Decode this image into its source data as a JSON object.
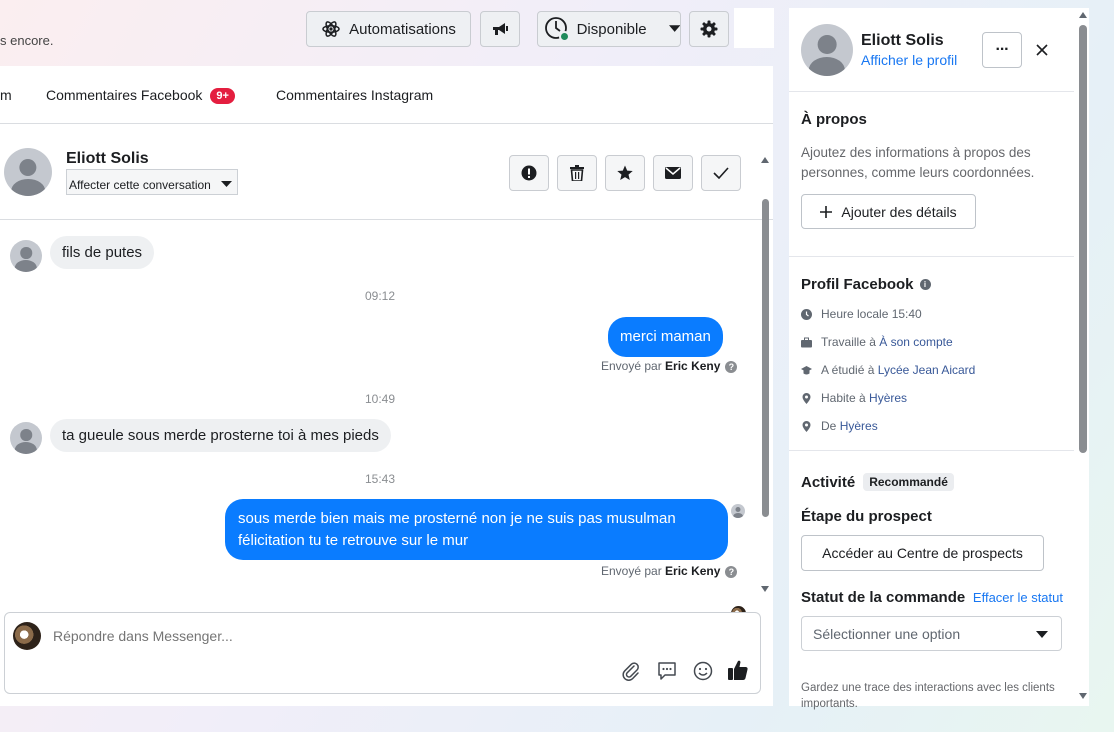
{
  "topbar": {
    "partial_text": "s encore.",
    "automations_label": "Automatisations",
    "status_label": "Disponible"
  },
  "tabs": [
    {
      "label": "m"
    },
    {
      "label": "Commentaires Facebook",
      "badge": "9+"
    },
    {
      "label": "Commentaires Instagram"
    }
  ],
  "conversation": {
    "name": "Eliott Solis",
    "assign_label": "Affecter cette conversation"
  },
  "messages": {
    "m1": "fils de putes",
    "t1": "09:12",
    "m2": "merci maman",
    "sent_prefix": "Envoyé par",
    "sender": "Eric Keny",
    "t2": "10:49",
    "m3": "ta gueule sous merde prosterne toi à mes pieds",
    "t3": "15:43",
    "m4_line1": "sous merde bien mais me prosterné non je ne suis pas musulman",
    "m4_line2": "félicitation tu te retrouve sur le mur"
  },
  "reply": {
    "placeholder": "Répondre dans Messenger..."
  },
  "side": {
    "name": "Eliott Solis",
    "profile_link": "Afficher le profil",
    "more_label": "···",
    "about_title": "À propos",
    "about_text_1": "Ajoutez des informations à propos des",
    "about_text_2": "personnes, comme leurs coordonnées.",
    "add_details": "Ajouter des détails",
    "fb_profile_title": "Profil Facebook",
    "local_time": "Heure locale 15:40",
    "works_prefix": "Travaille à",
    "works_link": "À son compte",
    "studied_prefix": "A étudié à",
    "studied_link": "Lycée Jean Aicard",
    "lives_prefix": "Habite à",
    "lives_link": "Hyères",
    "from_prefix": "De",
    "from_link": "Hyères",
    "activity_title": "Activité",
    "recommended": "Recommandé",
    "prospect_step": "Étape du prospect",
    "prospect_center": "Accéder au Centre de prospects",
    "order_status": "Statut de la commande",
    "clear_status": "Effacer le statut",
    "select_option": "Sélectionner une option",
    "footer_1": "Gardez une trace des interactions avec les clients",
    "footer_2": "importants."
  },
  "colors": {
    "accent": "#0a7cff",
    "badge": "#e41e3f",
    "online": "#31a24c"
  }
}
